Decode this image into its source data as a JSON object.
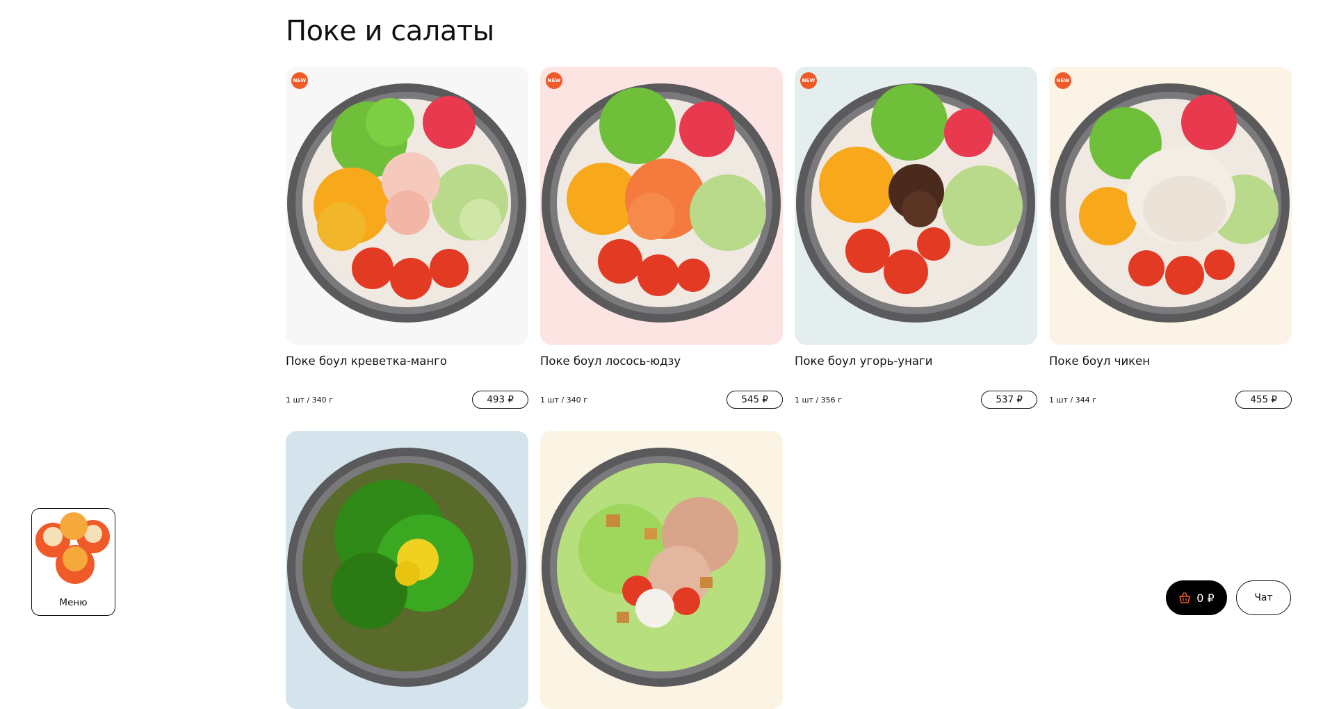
{
  "section": {
    "title": "Поке и салаты"
  },
  "products": [
    {
      "title": "Поке боул креветка-манго",
      "weight": "1 шт / 340 г",
      "price": "493 ₽",
      "badge": "NEW",
      "bg": "#f7f7f7",
      "protein": "shrimp"
    },
    {
      "title": "Поке боул лосось-юдзу",
      "weight": "1 шт / 340 г",
      "price": "545 ₽",
      "badge": "NEW",
      "bg": "#fbe4e1",
      "protein": "salmon"
    },
    {
      "title": "Поке боул угорь-унаги",
      "weight": "1 шт / 356 г",
      "price": "537 ₽",
      "badge": "NEW",
      "bg": "#e4eeee",
      "protein": "eel"
    },
    {
      "title": "Поке боул чикен",
      "weight": "1 шт / 344 г",
      "price": "455 ₽",
      "badge": "NEW",
      "bg": "#fbf3e5",
      "protein": "chicken"
    },
    {
      "bg": "#d4e3ec",
      "dish": "seaweed-salad"
    },
    {
      "bg": "#fbf3e4",
      "dish": "caesar-salad"
    }
  ],
  "menu_widget": {
    "label": "Меню"
  },
  "cart": {
    "total": "0 ₽",
    "icon": "basket-icon"
  },
  "chat": {
    "label": "Чат"
  },
  "colors": {
    "badge": "#f05a28",
    "cart_bg": "#000000",
    "text": "#111111"
  }
}
